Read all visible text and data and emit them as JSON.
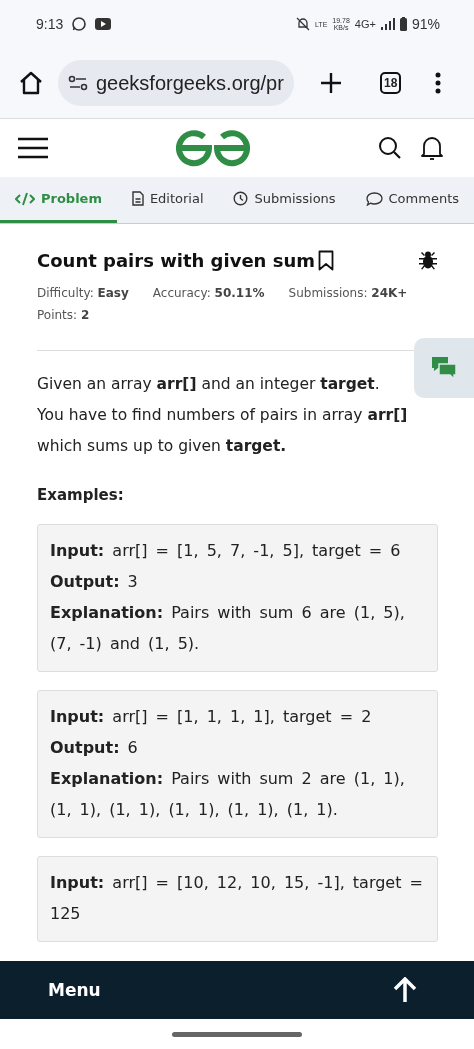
{
  "status_bar": {
    "time": "9:13",
    "volte": "LTE",
    "speed": "19.78",
    "speed_unit": "KB/s",
    "network": "4G+",
    "battery": "91%"
  },
  "browser": {
    "url": "geeksforgeeks.org/pr",
    "tab_count": "18"
  },
  "tabs": [
    {
      "label": "Problem",
      "kind": "code",
      "selected": true
    },
    {
      "label": "Editorial",
      "kind": "document",
      "selected": false
    },
    {
      "label": "Submissions",
      "kind": "clock",
      "selected": false
    },
    {
      "label": "Comments",
      "kind": "comment",
      "selected": false
    }
  ],
  "problem": {
    "title": "Count pairs with given sum",
    "meta": [
      {
        "label": "Difficulty:",
        "value": "Easy"
      },
      {
        "label": "Accuracy:",
        "value": "50.11%"
      },
      {
        "label": "Submissions:",
        "value": "24K+"
      },
      {
        "label": "Points:",
        "value": "2"
      }
    ],
    "description": "Given an array **arr[]** and an integer **target**. You have to find numbers of pairs in array **arr[]** which sums up to given **target.**",
    "examples_heading": "Examples:",
    "examples": [
      {
        "lines": [
          {
            "label": "Input:",
            "text": "arr[] = [1, 5, 7, -1, 5], target = 6"
          },
          {
            "label": "Output:",
            "text": "3"
          },
          {
            "label": "Explanation:",
            "text": "Pairs with sum 6 are (1, 5), (7, -1) and (1, 5)."
          }
        ]
      },
      {
        "lines": [
          {
            "label": "Input:",
            "text": "arr[] = [1, 1, 1, 1], target = 2"
          },
          {
            "label": "Output:",
            "text": "6"
          },
          {
            "label": "Explanation:",
            "text": "Pairs with sum 2 are (1, 1), (1, 1), (1, 1), (1, 1), (1, 1), (1, 1)."
          }
        ]
      },
      {
        "lines": [
          {
            "label": "Input:",
            "text": "arr[] = [10, 12, 10, 15, -1], target = 125"
          }
        ]
      }
    ]
  },
  "bottom_bar": {
    "menu_label": "Menu"
  }
}
